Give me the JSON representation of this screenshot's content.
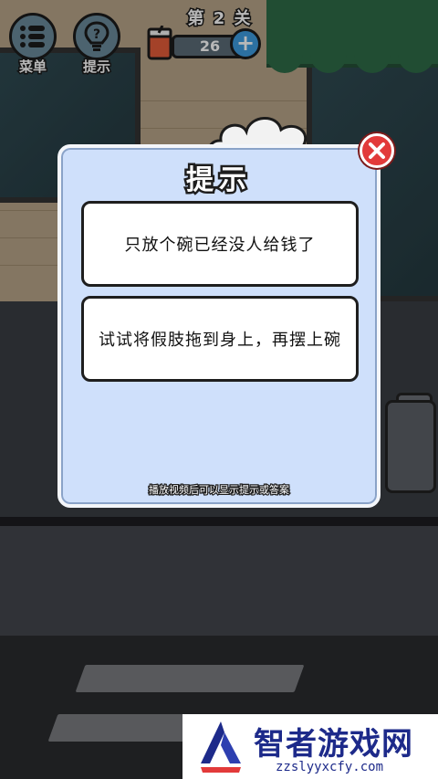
{
  "hud": {
    "menu_label": "菜单",
    "hint_label": "提示",
    "level_title": "第 2 关",
    "coins": "26",
    "plus": "+"
  },
  "dialog": {
    "title": "提示",
    "hints": [
      "只放个碗已经没人给钱了",
      "试试将假肢拖到身上，再摆上碗"
    ],
    "video_note": "播放视频后可以显示提示或答案",
    "close_icon": "close-icon"
  },
  "watermark": {
    "title": "智者游戏网",
    "url": "zzslyyxcfy.com"
  },
  "colors": {
    "dialog_bg": "#cfe0fb",
    "close_red": "#e23a3a",
    "plus_blue": "#3d9be0",
    "watermark_blue": "#1d2a8a"
  }
}
